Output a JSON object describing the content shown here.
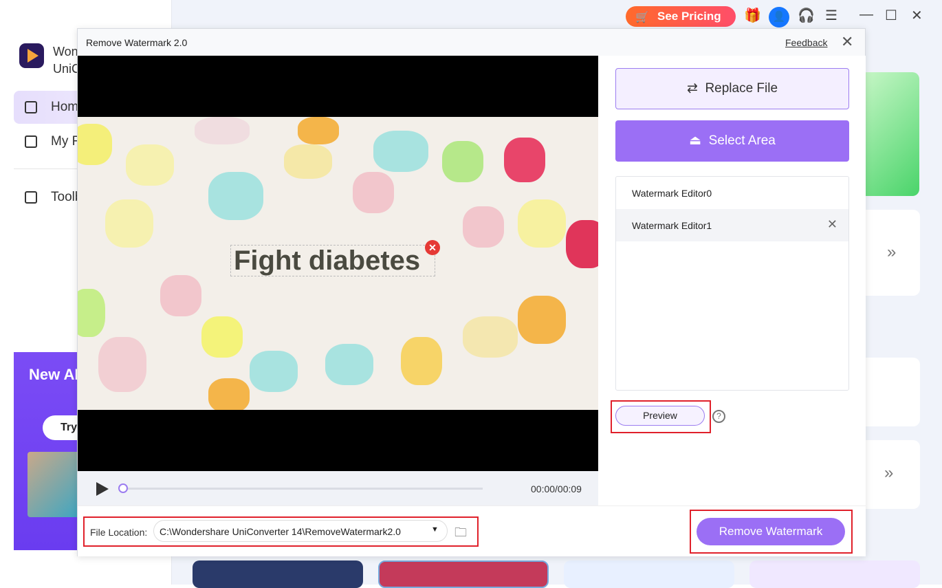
{
  "app": {
    "brand_line1": "Wondershare",
    "brand_line2": "UniConverter",
    "see_pricing": "See Pricing"
  },
  "sidebar": {
    "items": [
      {
        "label": "Home",
        "icon": "home-icon"
      },
      {
        "label": "My Files",
        "icon": "folder-icon"
      },
      {
        "label": "Toolbox",
        "icon": "toolbox-icon"
      }
    ],
    "promo": {
      "title": "New AI Animation",
      "try": "Try"
    }
  },
  "dialog": {
    "title": "Remove Watermark 2.0",
    "feedback": "Feedback",
    "watermark_text": "Fight diabetes",
    "time": "00:00/00:09",
    "progress": 0,
    "replace_file": "Replace File",
    "select_area": "Select Area",
    "editors": [
      "Watermark Editor0",
      "Watermark Editor1"
    ],
    "preview": "Preview",
    "file_location_label": "File Location:",
    "file_location": "C:\\Wondershare UniConverter 14\\RemoveWatermark2.0",
    "remove_watermark": "Remove Watermark"
  },
  "colors": {
    "accent": "#9b6ff5",
    "highlight": "#e0202a",
    "pricing": "#ff5a4a"
  }
}
